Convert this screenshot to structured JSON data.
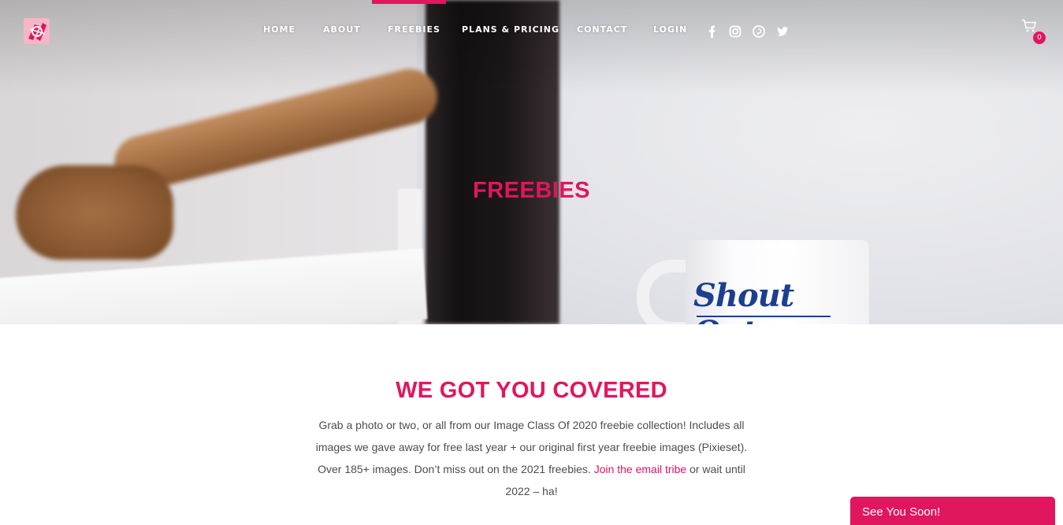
{
  "nav": {
    "items": [
      {
        "label": "HOME"
      },
      {
        "label": "ABOUT"
      },
      {
        "label": "FREEBIES",
        "active": true
      },
      {
        "label": "PLANS & PRICING"
      },
      {
        "label": "CONTACT"
      },
      {
        "label": "LOGIN"
      }
    ],
    "social_icons": [
      "facebook-icon",
      "instagram-icon",
      "pinterest-icon",
      "twitter-icon"
    ],
    "cart": {
      "icon": "cart-icon",
      "count": "0"
    }
  },
  "hero": {
    "title": "FREEBIES",
    "mug_text": "Shout Out"
  },
  "section": {
    "title": "WE GOT YOU COVERED",
    "intro_text": "Grab a photo or two, or all from our Image Class Of 2020 freebie collection! Includes all images we gave away for free last year + our original first year freebie images (Pixieset). Over 185+ images. Don’t miss out on the 2021 freebies. ",
    "intro_link": "Join the email tribe",
    "intro_tail": " or wait until 2022 – ha!"
  },
  "popup": {
    "label": "See You Soon!"
  },
  "colors": {
    "accent": "#e0165e",
    "text": "#4d4d4d",
    "nav_text": "#ffffff"
  }
}
